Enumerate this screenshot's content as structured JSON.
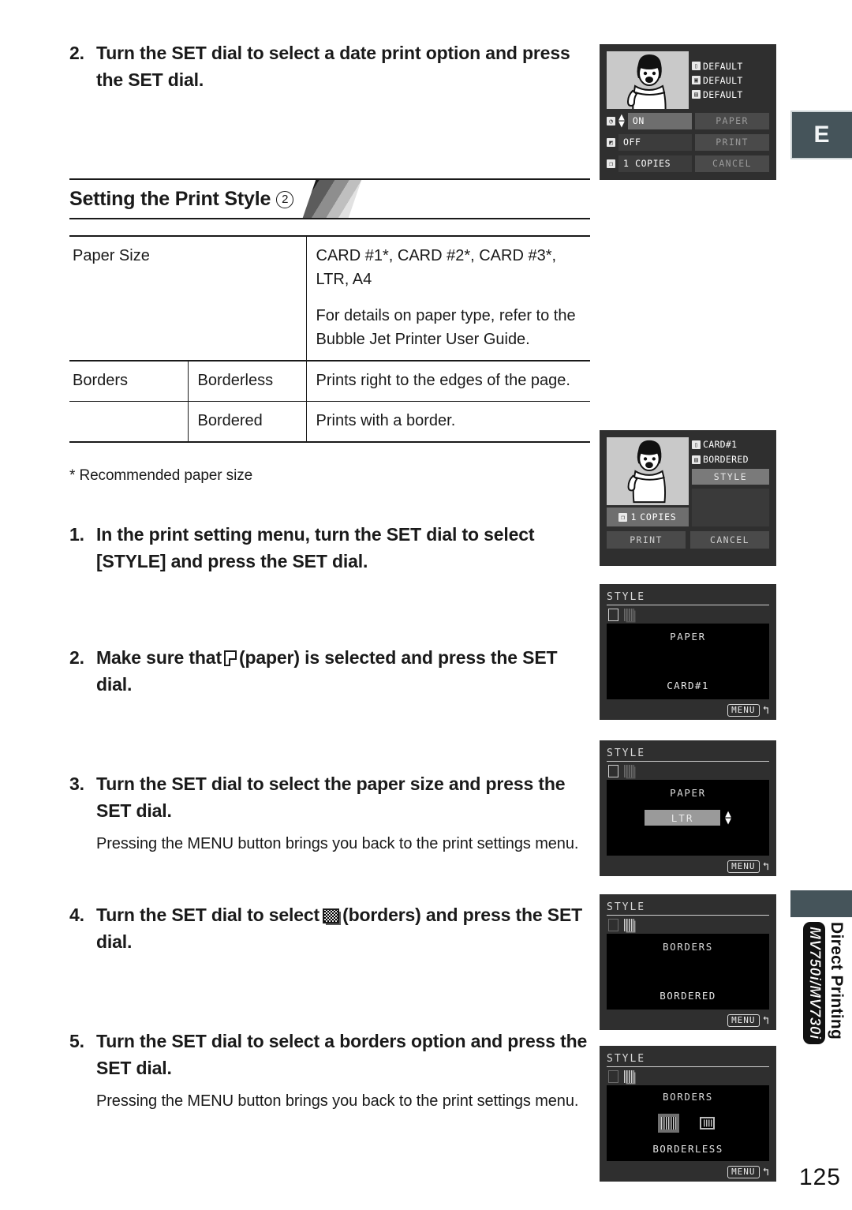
{
  "page": {
    "number": "125",
    "language_tab": "E",
    "side_tab_text": "Direct Printing",
    "model_badge": "MV750i/MV730i"
  },
  "intro_step": {
    "num": "2.",
    "text": "Turn the SET dial to select a date print option and press the SET dial."
  },
  "section": {
    "title": "Setting the Print Style",
    "marker": "2"
  },
  "table": {
    "rows": [
      {
        "label": "Paper Size",
        "sub": "",
        "desc_1": "CARD #1*, CARD #2*, CARD #3*, LTR, A4",
        "desc_2": "For details on paper type, refer to the Bubble Jet Printer User Guide."
      },
      {
        "label": "Borders",
        "sub": "Borderless",
        "desc_1": "Prints right to the edges of the page.",
        "desc_2": ""
      },
      {
        "label": "",
        "sub": "Bordered",
        "desc_1": "Prints with a border.",
        "desc_2": ""
      }
    ],
    "footnote": "* Recommended paper size"
  },
  "steps": [
    {
      "num": "1.",
      "text_before": "In the print setting menu, turn the SET dial to select [STYLE] and press the SET dial.",
      "icon": "",
      "text_after": "",
      "note": ""
    },
    {
      "num": "2.",
      "text_before": "Make sure that",
      "icon": "paper-icon",
      "text_after": "(paper) is selected and press the SET dial.",
      "note": ""
    },
    {
      "num": "3.",
      "text_before": "Turn the SET dial to select the paper size and press the SET dial.",
      "icon": "",
      "text_after": "",
      "note": "Pressing the MENU button brings you back to the print settings menu."
    },
    {
      "num": "4.",
      "text_before": "Turn the SET dial to select",
      "icon": "borders-icon",
      "text_after": "(borders) and press the SET dial.",
      "note": ""
    },
    {
      "num": "5.",
      "text_before": "Turn the SET dial to select a borders option and press the SET dial.",
      "icon": "",
      "text_after": "",
      "note": "Pressing the MENU button brings you back to the print settings menu."
    }
  ],
  "screens": {
    "date_print": {
      "options": [
        "DEFAULT",
        "DEFAULT",
        "DEFAULT"
      ],
      "row_date_value": "ON",
      "row_effect_value": "OFF",
      "row_copies_count": "1",
      "row_copies_label": "COPIES",
      "btn_paper": "PAPER",
      "btn_print": "PRINT",
      "btn_cancel": "CANCEL"
    },
    "print_settings": {
      "paper_value": "CARD#1",
      "borders_value": "BORDERED",
      "style_button": "STYLE",
      "copies_count": "1",
      "copies_label": "COPIES",
      "btn_print": "PRINT",
      "btn_cancel": "CANCEL"
    },
    "style_paper": {
      "title": "STYLE",
      "label": "PAPER",
      "value": "CARD#1",
      "menu": "MENU"
    },
    "style_paper_select": {
      "title": "STYLE",
      "label": "PAPER",
      "value": "LTR",
      "menu": "MENU"
    },
    "style_borders": {
      "title": "STYLE",
      "label": "BORDERS",
      "value": "BORDERED",
      "menu": "MENU"
    },
    "style_borders_select": {
      "title": "STYLE",
      "label": "BORDERS",
      "value": "BORDERLESS",
      "menu": "MENU"
    }
  }
}
